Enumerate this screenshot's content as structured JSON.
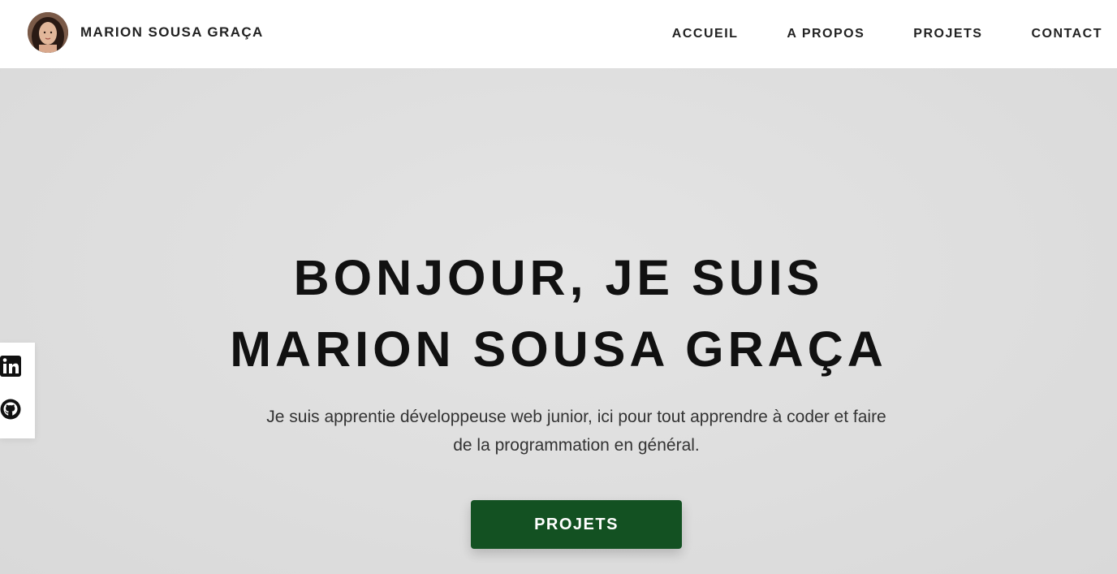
{
  "header": {
    "brand_name": "MARION SOUSA GRAÇA",
    "nav": [
      {
        "label": "ACCUEIL"
      },
      {
        "label": "A PROPOS"
      },
      {
        "label": "PROJETS"
      },
      {
        "label": "CONTACT"
      }
    ]
  },
  "hero": {
    "title_line1": "BONJOUR, JE SUIS",
    "title_line2": "MARION SOUSA GRAÇA",
    "subtitle_line1": "Je suis apprentie développeuse web junior, ici pour tout apprendre à coder et faire",
    "subtitle_line2": "de la programmation en général.",
    "cta_label": "PROJETS"
  },
  "social": {
    "icons": [
      "linkedin-icon",
      "github-icon"
    ]
  },
  "colors": {
    "cta_background": "#135122",
    "hero_background": "#dedede",
    "text": "#111111"
  }
}
